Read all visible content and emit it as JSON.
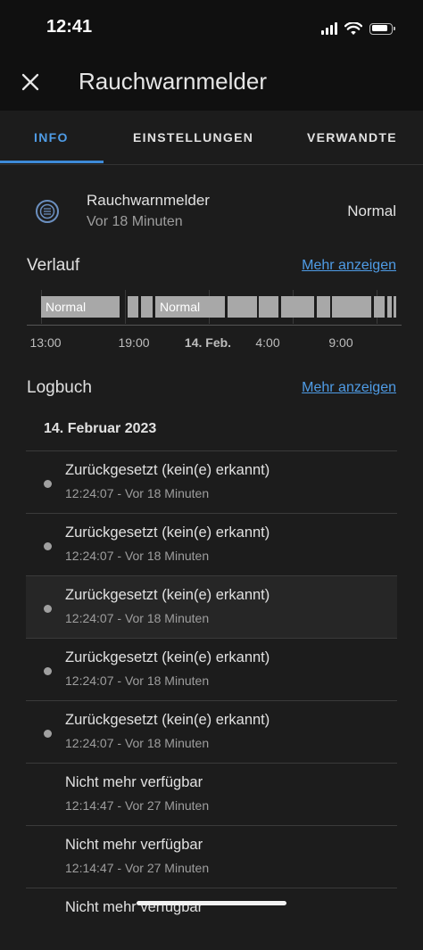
{
  "status_bar": {
    "time": "12:41"
  },
  "header": {
    "title": "Rauchwarnmelder",
    "close_icon": "close-icon"
  },
  "tabs": [
    {
      "label": "INFO",
      "active": true
    },
    {
      "label": "EINSTELLUNGEN",
      "active": false
    },
    {
      "label": "VERWANDTE",
      "active": false
    }
  ],
  "entity": {
    "icon": "smoke-detector-icon",
    "name": "Rauchwarnmelder",
    "last_changed": "Vor 18 Minuten",
    "state": "Normal"
  },
  "history": {
    "title": "Verlauf",
    "more_link": "Mehr anzeigen",
    "state_labels": [
      "Normal",
      "Normal"
    ],
    "ticks": [
      "13:00",
      "19:00",
      "14. Feb.",
      "4:00",
      "9:00"
    ]
  },
  "logbook": {
    "title": "Logbuch",
    "more_link": "Mehr anzeigen",
    "date": "14. Februar 2023",
    "entries": [
      {
        "title": "Zurückgesetzt (kein(e) erkannt)",
        "time": "12:24:07 - Vor 18 Minuten",
        "dot": true
      },
      {
        "title": "Zurückgesetzt (kein(e) erkannt)",
        "time": "12:24:07 - Vor 18 Minuten",
        "dot": true
      },
      {
        "title": "Zurückgesetzt (kein(e) erkannt)",
        "time": "12:24:07 - Vor 18 Minuten",
        "dot": true
      },
      {
        "title": "Zurückgesetzt (kein(e) erkannt)",
        "time": "12:24:07 - Vor 18 Minuten",
        "dot": true
      },
      {
        "title": "Zurückgesetzt (kein(e) erkannt)",
        "time": "12:24:07 - Vor 18 Minuten",
        "dot": true
      },
      {
        "title": "Nicht mehr verfügbar",
        "time": "12:14:47 - Vor 27 Minuten",
        "dot": false
      },
      {
        "title": "Nicht mehr verfügbar",
        "time": "12:14:47 - Vor 27 Minuten",
        "dot": false
      },
      {
        "title": "Nicht mehr verfügbar",
        "time": "",
        "dot": false
      }
    ]
  },
  "colors": {
    "accent": "#4f9ce6",
    "background": "#1c1c1c",
    "bar": "#a8a8a8"
  }
}
